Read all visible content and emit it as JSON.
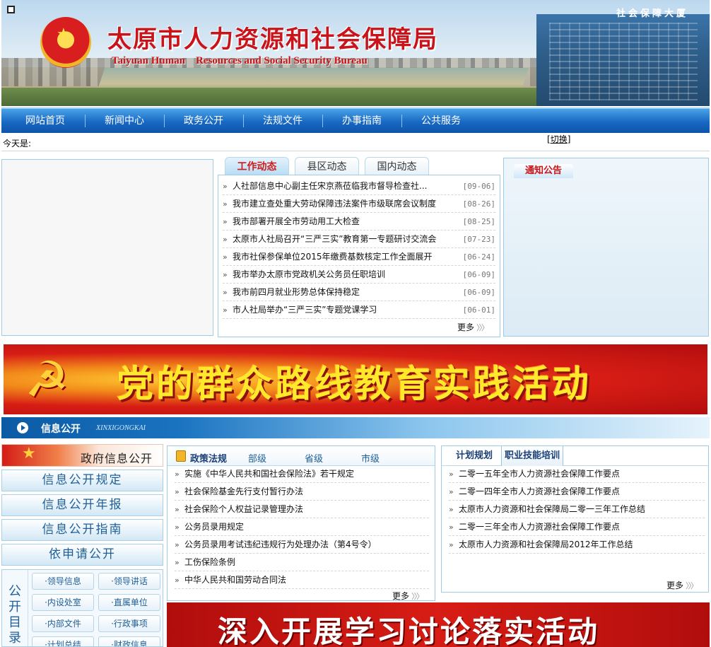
{
  "header": {
    "title": "太原市人力资源和社会保障局",
    "subtitle": "Taiyuan Human    Resources and Social Security Bureau",
    "building_sign": "社会保障大厦"
  },
  "nav": {
    "items": [
      "网站首页",
      "新闻中心",
      "政务公开",
      "法规文件",
      "办事指南",
      "公共服务"
    ]
  },
  "datebar": {
    "today_label": "今天是:",
    "switch_label": "切换"
  },
  "news": {
    "tabs": [
      "工作动态",
      "县区动态",
      "国内动态"
    ],
    "items": [
      {
        "title": "人社部信息中心副主任宋京燕莅临我市督导检查社...",
        "date": "[09-06]"
      },
      {
        "title": "我市建立查处重大劳动保障违法案件市级联席会议制度",
        "date": "[08-26]"
      },
      {
        "title": "我市部署开展全市劳动用工大检查",
        "date": "[08-25]"
      },
      {
        "title": "太原市人社局召开“三严三实”教育第一专题研讨交流会",
        "date": "[07-23]"
      },
      {
        "title": "我市社保参保单位2015年缴费基数核定工作全面展开",
        "date": "[06-24]"
      },
      {
        "title": "我市举办太原市党政机关公务员任职培训",
        "date": "[06-09]"
      },
      {
        "title": "我市前四月就业形势总体保持稳定",
        "date": "[06-09]"
      },
      {
        "title": "市人社局举办“三严三实”专题党课学习",
        "date": "[06-01]"
      }
    ],
    "more": "更多"
  },
  "notice": {
    "title": "通知公告"
  },
  "banner1": {
    "text": "党的群众路线教育实践活动"
  },
  "section": {
    "title": "信息公开",
    "english": "XINXIGONGKAI"
  },
  "gov": {
    "head": "政府信息公开",
    "buttons": [
      "信息公开规定",
      "信息公开年报",
      "信息公开指南",
      "依申请公开"
    ],
    "catalog_label": "公开目录",
    "catalog_items": [
      "·领导信息",
      "·领导讲话",
      "·内设处室",
      "·直属单位",
      "·内部文件",
      "·行政事项",
      "·计划总结",
      "·财政信息"
    ]
  },
  "policy": {
    "tabs": [
      "政策法规",
      "部级",
      "省级",
      "市级"
    ],
    "items": [
      "实施《中华人民共和国社会保险法》若干规定",
      "社会保险基金先行支付暂行办法",
      "社会保险个人权益记录管理办法",
      "公务员录用规定",
      "公务员录用考试违纪违规行为处理办法（第4号令）",
      "工伤保险条例",
      "中华人民共和国劳动合同法"
    ],
    "more": "更多"
  },
  "plan": {
    "tabs": [
      "计划规划",
      "职业技能培训"
    ],
    "items": [
      "二零一五年全市人力资源社会保障工作要点",
      "二零一四年全市人力资源社会保障工作要点",
      "太原市人力资源和社会保障局二零一三年工作总结",
      "二零一三年全市人力资源社会保障工作要点",
      "太原市人力资源和社会保障局2012年工作总结"
    ],
    "more": "更多"
  },
  "banner2": {
    "text": "深入开展学习讨论落实活动"
  }
}
